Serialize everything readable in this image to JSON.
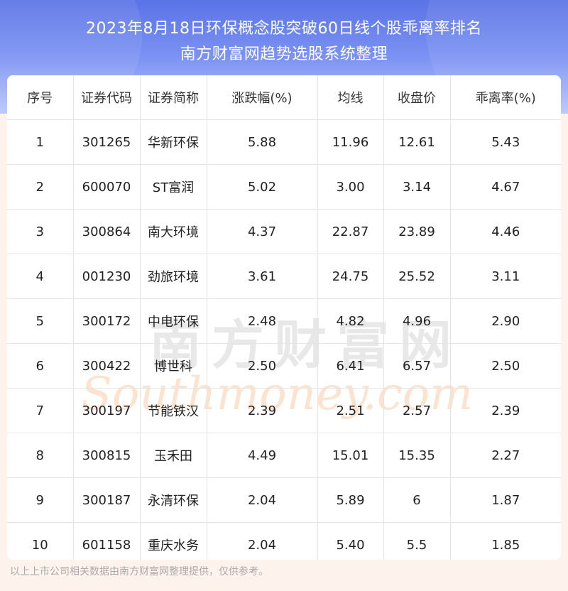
{
  "header": {
    "title_line1": "2023年8月18日环保概念股突破60日线个股乖离率排名",
    "title_line2": "南方财富网趋势选股系统整理"
  },
  "table": {
    "columns": [
      "序号",
      "证券代码",
      "证券简称",
      "涨跌幅(%)",
      "均线",
      "收盘价",
      "乖离率(%)"
    ],
    "rows": [
      [
        "1",
        "301265",
        "华新环保",
        "5.88",
        "11.96",
        "12.61",
        "5.43"
      ],
      [
        "2",
        "600070",
        "ST富润",
        "5.02",
        "3.00",
        "3.14",
        "4.67"
      ],
      [
        "3",
        "300864",
        "南大环境",
        "4.37",
        "22.87",
        "23.89",
        "4.46"
      ],
      [
        "4",
        "001230",
        "劲旅环境",
        "3.61",
        "24.75",
        "25.52",
        "3.11"
      ],
      [
        "5",
        "300172",
        "中电环保",
        "2.48",
        "4.82",
        "4.96",
        "2.90"
      ],
      [
        "6",
        "300422",
        "博世科",
        "2.50",
        "6.41",
        "6.57",
        "2.50"
      ],
      [
        "7",
        "300197",
        "节能铁汉",
        "2.39",
        "2.51",
        "2.57",
        "2.39"
      ],
      [
        "8",
        "300815",
        "玉禾田",
        "4.49",
        "15.01",
        "15.35",
        "2.27"
      ],
      [
        "9",
        "300187",
        "永清环保",
        "2.04",
        "5.89",
        "6",
        "1.87"
      ],
      [
        "10",
        "601158",
        "重庆水务",
        "2.04",
        "5.40",
        "5.5",
        "1.85"
      ]
    ]
  },
  "watermark": {
    "line1": "南方财富网",
    "line2": "Southmoney.com"
  },
  "footer": {
    "text": "以上上市公司相关数据由南方财富网整理提供，仅供参考。"
  }
}
